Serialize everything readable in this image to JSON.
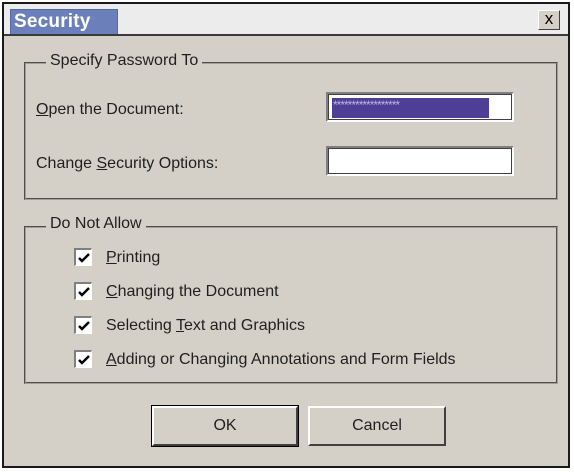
{
  "window": {
    "title": "Security",
    "close_label": "x"
  },
  "password_group": {
    "legend": "Specify Password To",
    "open_document": {
      "label": "Open the Document:",
      "mnemonic": "O",
      "value": "******************"
    },
    "change_security": {
      "label_prefix": "Change ",
      "label_mnemonic": "S",
      "label_suffix": "ecurity Options:",
      "value": ""
    }
  },
  "restrictions_group": {
    "legend": "Do Not Allow",
    "items": [
      {
        "prefix": "",
        "mnemonic": "P",
        "suffix": "rinting",
        "checked": true
      },
      {
        "prefix": "",
        "mnemonic": "C",
        "suffix": "hanging the Document",
        "checked": true
      },
      {
        "prefix": "Selecting ",
        "mnemonic": "T",
        "suffix": "ext and Graphics",
        "checked": true
      },
      {
        "prefix": "",
        "mnemonic": "A",
        "suffix": "dding or Changing Annotations and Form Fields",
        "checked": true
      }
    ]
  },
  "buttons": {
    "ok": "OK",
    "cancel": "Cancel"
  }
}
